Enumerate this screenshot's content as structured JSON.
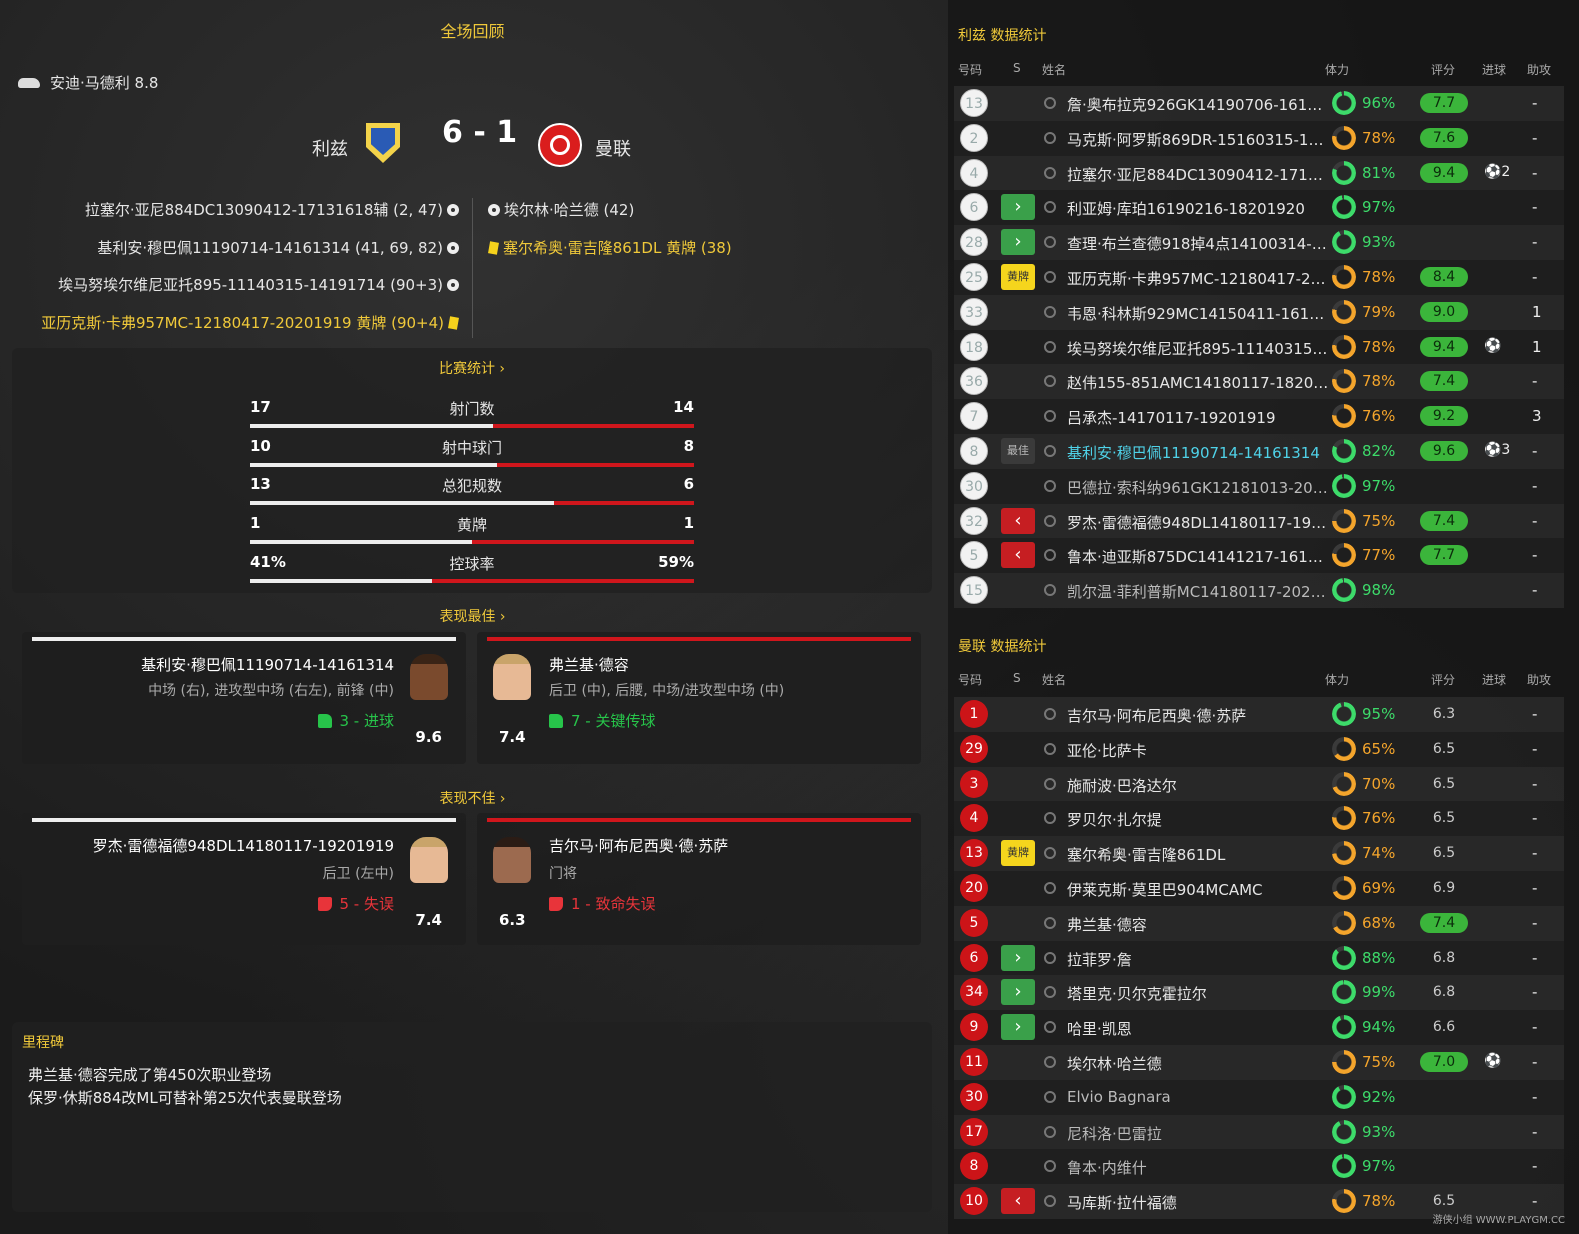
{
  "summary": {
    "title": "全场回顾",
    "motm": "安迪·马德利 8.8",
    "home_team": "利兹",
    "away_team": "曼联",
    "score": "6 - 1",
    "home_events": [
      "拉塞尔·亚尼884DC13090412-17131618辅 (2, 47)",
      "基利安·穆巴佩11190714-14161314 (41, 69, 82)",
      "埃马努埃尔维尼亚托895-11140315-14191714 (90+3)",
      "亚历克斯·卡弗957MC-12180417-20201919 黄牌 (90+4)"
    ],
    "away_events": [
      "埃尔林·哈兰德 (42)",
      "塞尔希奥·雷吉隆861DL 黄牌 (38)"
    ]
  },
  "match_stats": {
    "link": "比赛统计 ›",
    "rows": [
      {
        "home": "17",
        "label": "射门数",
        "away": "14",
        "home_share": 0.548
      },
      {
        "home": "10",
        "label": "射中球门",
        "away": "8",
        "home_share": 0.556
      },
      {
        "home": "13",
        "label": "总犯规数",
        "away": "6",
        "home_share": 0.684
      },
      {
        "home": "1",
        "label": "黄牌",
        "away": "1",
        "home_share": 0.5
      },
      {
        "home": "41%",
        "label": "控球率",
        "away": "59%",
        "home_share": 0.41
      }
    ]
  },
  "best": {
    "link": "表现最佳 ›",
    "home": {
      "name": "基利安·穆巴佩11190714-14161314",
      "positions": "中场 (右), 进攻型中场 (右左), 前锋 (中)",
      "stat": "3 - 进球",
      "rating": "9.6"
    },
    "away": {
      "name": "弗兰基·德容",
      "positions": "后卫 (中), 后腰, 中场/进攻型中场 (中)",
      "stat": "7 - 关键传球",
      "rating": "7.4"
    }
  },
  "worst": {
    "link": "表现不佳 ›",
    "home": {
      "name": "罗杰·雷德福德948DL14180117-19201919",
      "positions": "后卫 (左中)",
      "stat": "5 - 失误",
      "rating": "7.4"
    },
    "away": {
      "name": "吉尔马·阿布尼西奥·德·苏萨",
      "positions": "门将",
      "stat": "1 - 致命失误",
      "rating": "6.3"
    }
  },
  "milestones": {
    "title": "里程碑",
    "items": [
      "弗兰基·德容完成了第450次职业登场",
      "保罗·休斯884改ML可替补第25次代表曼联登场"
    ]
  },
  "table_headers": {
    "num": "号码",
    "s": "S",
    "name": "姓名",
    "stamina": "体力",
    "rating": "评分",
    "goals": "进球",
    "assists": "助攻"
  },
  "home_table": {
    "title": "利兹 数据统计",
    "players": [
      {
        "num": "13",
        "s": "",
        "name": "詹·奥布拉克926GK14190706-16101...",
        "stamina": 0.96,
        "stamina_text": "96%",
        "rating": "7.7",
        "green": true,
        "goals": "",
        "assists": "-"
      },
      {
        "num": "2",
        "s": "",
        "name": "马克斯·阿罗斯869DR-15160315-151...",
        "stamina": 0.78,
        "stamina_text": "78%",
        "rating": "7.6",
        "green": true,
        "goals": "",
        "assists": "-"
      },
      {
        "num": "4",
        "s": "",
        "name": "拉塞尔·亚尼884DC13090412-17131...",
        "stamina": 0.81,
        "stamina_text": "81%",
        "rating": "9.4",
        "green": true,
        "goals": "⚽2",
        "assists": "-"
      },
      {
        "num": "6",
        "s": "in",
        "name": "利亚姆·库珀16190216-18201920",
        "stamina": 0.97,
        "stamina_text": "97%",
        "rating": "",
        "green": false,
        "goals": "",
        "assists": "-"
      },
      {
        "num": "28",
        "s": "in",
        "name": "查理·布兰查德918掉4点14100314-1...",
        "stamina": 0.93,
        "stamina_text": "93%",
        "rating": "",
        "green": false,
        "goals": "",
        "assists": "-"
      },
      {
        "num": "25",
        "s": "黄牌",
        "name": "亚历克斯·卡弗957MC-12180417-20...",
        "stamina": 0.78,
        "stamina_text": "78%",
        "rating": "8.4",
        "green": true,
        "goals": "",
        "assists": "-"
      },
      {
        "num": "33",
        "s": "",
        "name": "韦恩·科林斯929MC14150411-161614...",
        "stamina": 0.79,
        "stamina_text": "79%",
        "rating": "9.0",
        "green": true,
        "goals": "",
        "assists": "1"
      },
      {
        "num": "18",
        "s": "",
        "name": "埃马努埃尔维尼亚托895-11140315-...",
        "stamina": 0.78,
        "stamina_text": "78%",
        "rating": "9.4",
        "green": true,
        "goals": "⚽",
        "assists": "1"
      },
      {
        "num": "36",
        "s": "",
        "name": "赵伟155-851AMC14180117-18201919",
        "stamina": 0.78,
        "stamina_text": "78%",
        "rating": "7.4",
        "green": true,
        "goals": "",
        "assists": "-"
      },
      {
        "num": "7",
        "s": "",
        "name": "吕承杰-14170117-19201919",
        "stamina": 0.76,
        "stamina_text": "76%",
        "rating": "9.2",
        "green": true,
        "goals": "",
        "assists": "3"
      },
      {
        "num": "8",
        "s": "最佳",
        "name": "基利安·穆巴佩11190714-14161314",
        "stamina": 0.82,
        "stamina_text": "82%",
        "rating": "9.6",
        "green": true,
        "goals": "⚽3",
        "assists": "-",
        "highlight": true
      },
      {
        "num": "30",
        "s": "",
        "name": "巴德拉·索科纳961GK12181013-2017...",
        "stamina": 0.97,
        "stamina_text": "97%",
        "rating": "",
        "green": false,
        "goals": "",
        "assists": "-",
        "dim": true
      },
      {
        "num": "32",
        "s": "out",
        "name": "罗杰·雷德福德948DL14180117-1920...",
        "stamina": 0.75,
        "stamina_text": "75%",
        "rating": "7.4",
        "green": true,
        "goals": "",
        "assists": "-"
      },
      {
        "num": "5",
        "s": "out",
        "name": "鲁本·迪亚斯875DC14141217-161912...",
        "stamina": 0.77,
        "stamina_text": "77%",
        "rating": "7.7",
        "green": true,
        "goals": "",
        "assists": "-"
      },
      {
        "num": "15",
        "s": "",
        "name": "凯尔温·菲利普斯MC14180117-2020...",
        "stamina": 0.98,
        "stamina_text": "98%",
        "rating": "",
        "green": false,
        "goals": "",
        "assists": "-",
        "dim": true
      }
    ]
  },
  "away_table": {
    "title": "曼联 数据统计",
    "players": [
      {
        "num": "1",
        "s": "",
        "name": "吉尔马·阿布尼西奥·德·苏萨",
        "stamina": 0.95,
        "stamina_text": "95%",
        "rating": "6.3",
        "green": false,
        "goals": "",
        "assists": "-"
      },
      {
        "num": "29",
        "s": "",
        "name": "亚伦·比萨卡",
        "stamina": 0.65,
        "stamina_text": "65%",
        "rating": "6.5",
        "green": false,
        "goals": "",
        "assists": "-"
      },
      {
        "num": "3",
        "s": "",
        "name": "施耐波·巴洛达尔",
        "stamina": 0.7,
        "stamina_text": "70%",
        "rating": "6.5",
        "green": false,
        "goals": "",
        "assists": "-"
      },
      {
        "num": "4",
        "s": "",
        "name": "罗贝尔·扎尔提",
        "stamina": 0.76,
        "stamina_text": "76%",
        "rating": "6.5",
        "green": false,
        "goals": "",
        "assists": "-"
      },
      {
        "num": "13",
        "s": "黄牌",
        "name": "塞尔希奥·雷吉隆861DL",
        "stamina": 0.74,
        "stamina_text": "74%",
        "rating": "6.5",
        "green": false,
        "goals": "",
        "assists": "-"
      },
      {
        "num": "20",
        "s": "",
        "name": "伊莱克斯·莫里巴904MCAMC",
        "stamina": 0.69,
        "stamina_text": "69%",
        "rating": "6.9",
        "green": false,
        "goals": "",
        "assists": "-"
      },
      {
        "num": "5",
        "s": "",
        "name": "弗兰基·德容",
        "stamina": 0.68,
        "stamina_text": "68%",
        "rating": "7.4",
        "green": true,
        "goals": "",
        "assists": "-"
      },
      {
        "num": "6",
        "s": "in",
        "name": "拉菲罗·詹",
        "stamina": 0.88,
        "stamina_text": "88%",
        "rating": "6.8",
        "green": false,
        "goals": "",
        "assists": "-"
      },
      {
        "num": "34",
        "s": "in",
        "name": "塔里克·贝尔克霍拉尔",
        "stamina": 0.99,
        "stamina_text": "99%",
        "rating": "6.8",
        "green": false,
        "goals": "",
        "assists": "-"
      },
      {
        "num": "9",
        "s": "in",
        "name": "哈里·凯恩",
        "stamina": 0.94,
        "stamina_text": "94%",
        "rating": "6.6",
        "green": false,
        "goals": "",
        "assists": "-"
      },
      {
        "num": "11",
        "s": "",
        "name": "埃尔林·哈兰德",
        "stamina": 0.75,
        "stamina_text": "75%",
        "rating": "7.0",
        "green": true,
        "goals": "⚽",
        "assists": "-"
      },
      {
        "num": "30",
        "s": "",
        "name": "Elvio Bagnara",
        "stamina": 0.92,
        "stamina_text": "92%",
        "rating": "",
        "green": false,
        "goals": "",
        "assists": "-",
        "dim": true
      },
      {
        "num": "17",
        "s": "",
        "name": "尼科洛·巴雷拉",
        "stamina": 0.93,
        "stamina_text": "93%",
        "rating": "",
        "green": false,
        "goals": "",
        "assists": "-",
        "dim": true
      },
      {
        "num": "8",
        "s": "",
        "name": "鲁本·内维什",
        "stamina": 0.97,
        "stamina_text": "97%",
        "rating": "",
        "green": false,
        "goals": "",
        "assists": "-",
        "dim": true
      },
      {
        "num": "10",
        "s": "out",
        "name": "马库斯·拉什福德",
        "stamina": 0.78,
        "stamina_text": "78%",
        "rating": "6.5",
        "green": false,
        "goals": "",
        "assists": "-"
      }
    ]
  },
  "watermark": "游侠小组 WWW.PLAYGM.CC",
  "colors": {
    "accent": "#f0c93a",
    "home_bar": "#ededed",
    "away_bar": "#d0161c",
    "rating_green": "#3bb53b",
    "stamina_green": "#3ddb6a",
    "stamina_orange": "#f4a52c"
  }
}
